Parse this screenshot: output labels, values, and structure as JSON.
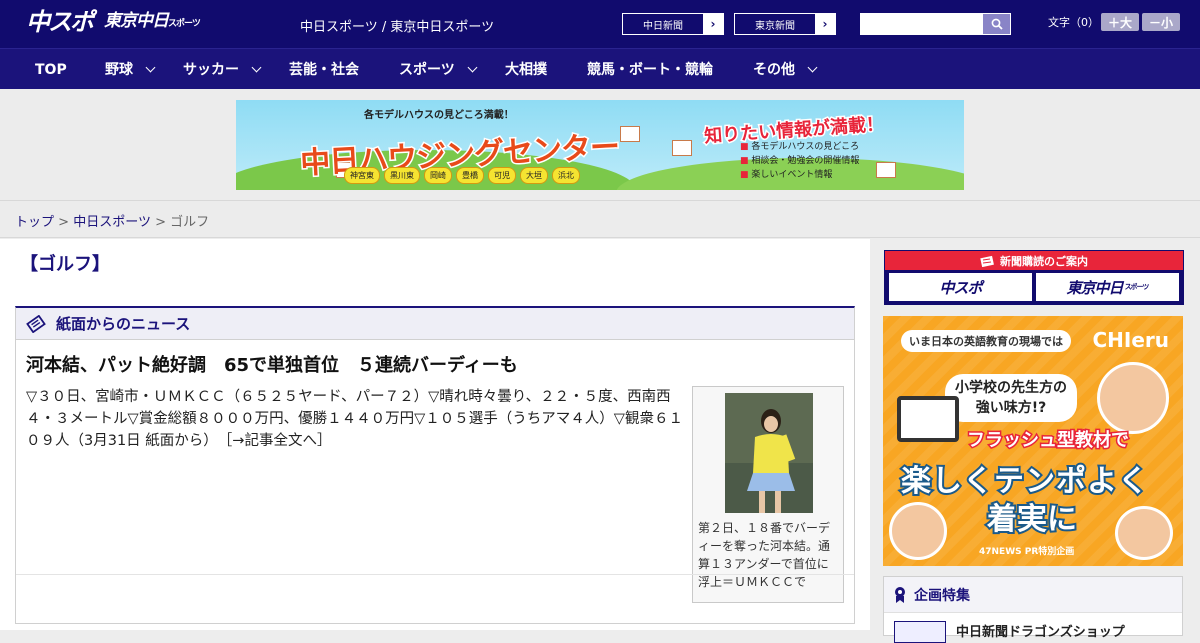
{
  "header": {
    "logo_main": "中スポ",
    "logo_sub": "東京中日",
    "logo_sub_small": "スポーツ",
    "site_name": "中日スポーツ / 東京中日スポーツ",
    "links": [
      {
        "label": "中日新聞"
      },
      {
        "label": "東京新聞"
      }
    ],
    "search_placeholder": "",
    "font_size_label": "文字（0）",
    "font_larger": "＋大",
    "font_smaller": "－小"
  },
  "nav": {
    "items": [
      {
        "label": "TOP",
        "has_menu": false
      },
      {
        "label": "野球",
        "has_menu": true
      },
      {
        "label": "サッカー",
        "has_menu": true
      },
      {
        "label": "芸能・社会",
        "has_menu": false
      },
      {
        "label": "スポーツ",
        "has_menu": true
      },
      {
        "label": "大相撲",
        "has_menu": false
      },
      {
        "label": "競馬・ボート・競輪",
        "has_menu": false
      },
      {
        "label": "その他",
        "has_menu": true
      }
    ]
  },
  "banner_ad": {
    "top_text": "各モデルハウスの見どころ満載！",
    "title": "中日ハウジングセンター",
    "right_title": "知りたい情報が満載！",
    "bullets": [
      "各モデルハウスの見どころ",
      "相談会・勉強会の開催情報",
      "楽しいイベント情報"
    ],
    "cities": [
      "神宮東",
      "黒川東",
      "岡崎",
      "豊橋",
      "可児",
      "大垣",
      "浜北"
    ]
  },
  "breadcrumb": {
    "items": [
      "トップ",
      "中日スポーツ"
    ],
    "current": "ゴルフ",
    "separator": ">"
  },
  "page": {
    "title": "【ゴルフ】"
  },
  "news_panel": {
    "heading": "紙面からのニュース",
    "article_title": "河本結、パット絶好調　65で単独首位　５連続バーディーも",
    "article_body": "▽３０日、宮崎市・ＵＭＫＣＣ（６５２５ヤード、パー７２）▽晴れ時々曇り、２２・５度、西南西４・３メートル▽賞金総額８０００万円、優勝１４４０万円▽１０５選手（うちアマ４人）▽観衆６１０９人（3月31日 紙面から）",
    "more_link": "［→記事全文へ］",
    "photo_caption": "第２日、１８番でバーディーを奪った河本結。通算１３アンダーで首位に浮上＝ＵＭＫＣＣで"
  },
  "sidebar": {
    "subscribe_heading": "新聞購読のご案内",
    "subscribe_logos": [
      {
        "label": "中スポ",
        "small": ""
      },
      {
        "label": "東京中日",
        "small": "スポーツ"
      }
    ],
    "ad": {
      "top_text": "いま日本の英語教育の現場では",
      "brand": "CHIeru",
      "question_line1": "小学校の先生方の",
      "question_line2": "強い味方!?",
      "flash": "フラッシュ型教材で",
      "big1": "楽しくテンポよく",
      "big2": "着実に",
      "footer": "47NEWS PR特別企画"
    },
    "feature_heading": "企画特集",
    "feature_item": "中日新聞ドラゴンズショップ"
  },
  "colors": {
    "header_bg": "#110b6e",
    "nav_bg": "#1b137b",
    "accent_red": "#e8253a",
    "ad_orange": "#f8a623"
  }
}
